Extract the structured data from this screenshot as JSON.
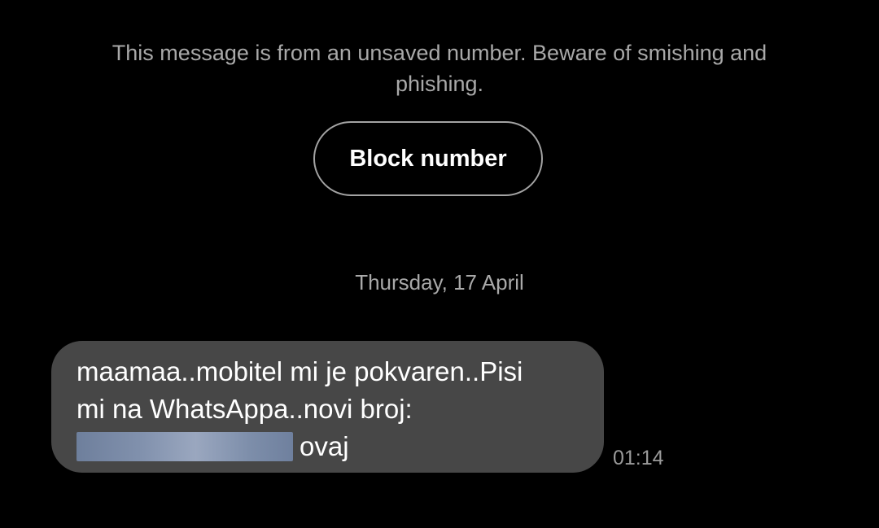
{
  "warning_banner": {
    "text": "This message is from an unsaved number. Beware of smishing and phishing."
  },
  "block_button": {
    "label": "Block number"
  },
  "date_separator": {
    "text": "Thursday, 17 April"
  },
  "message": {
    "line1": "maamaa..mobitel mi je pokvaren..Pisi",
    "line2": "mi na WhatsAppa..novi broj:",
    "line3_suffix": "ovaj",
    "timestamp": "01:14",
    "bubble_color": "#474747"
  },
  "colors": {
    "background": "#000000",
    "secondary_text": "#a9a9a9",
    "button_border": "#a3a3a3"
  }
}
